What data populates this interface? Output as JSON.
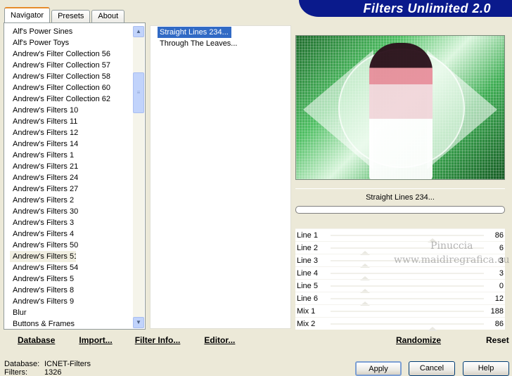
{
  "app": {
    "title": "Filters Unlimited 2.0"
  },
  "tabs": [
    "Navigator",
    "Presets",
    "About"
  ],
  "filter_list": [
    "Alf's Power Sines",
    "Alf's Power Toys",
    "Andrew's Filter Collection 56",
    "Andrew's Filter Collection 57",
    "Andrew's Filter Collection 58",
    "Andrew's Filter Collection 60",
    "Andrew's Filter Collection 62",
    "Andrew's Filters 10",
    "Andrew's Filters 11",
    "Andrew's Filters 12",
    "Andrew's Filters 14",
    "Andrew's Filters 1",
    "Andrew's Filters 21",
    "Andrew's Filters 24",
    "Andrew's Filters 27",
    "Andrew's Filters 2",
    "Andrew's Filters 30",
    "Andrew's Filters 3",
    "Andrew's Filters 4",
    "Andrew's Filters 50",
    "Andrew's Filters 51",
    "Andrew's Filters 54",
    "Andrew's Filters 5",
    "Andrew's Filters 8",
    "Andrew's Filters 9",
    "Blur",
    "Buttons & Frames"
  ],
  "selected_filter_index": 20,
  "sub_filters": [
    "Straight Lines 234...",
    "Through The Leaves..."
  ],
  "selected_sub_filter": 0,
  "current_filter": "Straight Lines 234...",
  "progress": 0,
  "sliders": [
    {
      "name": "Line 1",
      "value": "86"
    },
    {
      "name": "Line 2",
      "value": "6"
    },
    {
      "name": "Line 3",
      "value": "3"
    },
    {
      "name": "Line 4",
      "value": "3"
    },
    {
      "name": "Line 5",
      "value": "0"
    },
    {
      "name": "Line 6",
      "value": "12"
    },
    {
      "name": "Mix 1",
      "value": "188"
    },
    {
      "name": "Mix 2",
      "value": "86"
    }
  ],
  "watermark": {
    "line1": "Pinuccia",
    "line2": "www.maidiregrafica.eu"
  },
  "left_buttons": [
    "Database",
    "Import...",
    "Filter Info...",
    "Editor..."
  ],
  "right_buttons": [
    "Randomize",
    "Reset"
  ],
  "status": {
    "database_label": "Database:",
    "database_value": "ICNET-Filters",
    "filters_label": "Filters:",
    "filters_value": "1326"
  },
  "dialog_buttons": {
    "apply": "Apply",
    "cancel": "Cancel",
    "help": "Help"
  },
  "colors": {
    "banner": "#0a1a8c",
    "selection": "#316ac5",
    "tab_accent": "#e68b2c"
  }
}
